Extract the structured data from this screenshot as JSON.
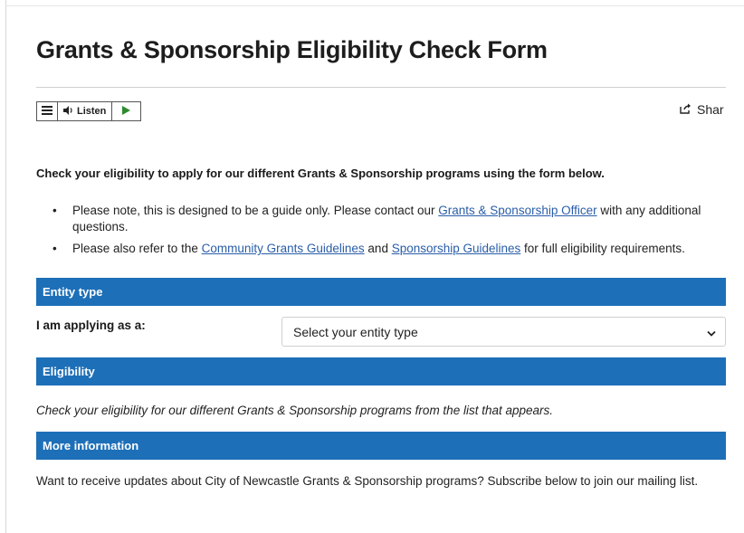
{
  "page": {
    "title": "Grants & Sponsorship Eligibility Check Form"
  },
  "toolbar": {
    "listen_label": "Listen",
    "menu_icon": "hamburger-menu-icon",
    "speaker_icon": "speaker-icon",
    "play_icon": "play-icon",
    "share_label": "Shar",
    "share_icon": "share-icon",
    "play_color": "#2e8b2e"
  },
  "intro": "Check your eligibility to apply for our different Grants & Sponsorship programs using the form below.",
  "notes": [
    {
      "before": "Please note, this is designed to be a guide only. Please contact our ",
      "link": "Grants & Sponsorship Officer",
      "after": " with any additional questions."
    },
    {
      "before": "Please also refer to the ",
      "link": "Community Grants Guidelines",
      "middle": " and ",
      "link2": "Sponsorship Guidelines",
      "after": " for full eligibility requirements."
    }
  ],
  "sections": {
    "entity_type": "Entity type",
    "eligibility": "Eligibility",
    "more_information": "More information"
  },
  "form": {
    "label": "I am applying as a:",
    "select_value": "Select your entity type",
    "chevron_icon": "chevron-down-icon"
  },
  "eligibility_text": "Check your eligibility for our different Grants & Sponsorship programs from the list that appears.",
  "more_text": "Want to receive updates about City of Newcastle Grants & Sponsorship programs? Subscribe below to join our mailing list.",
  "colors": {
    "section_bar": "#1d6fb8",
    "link": "#2a5da8"
  }
}
